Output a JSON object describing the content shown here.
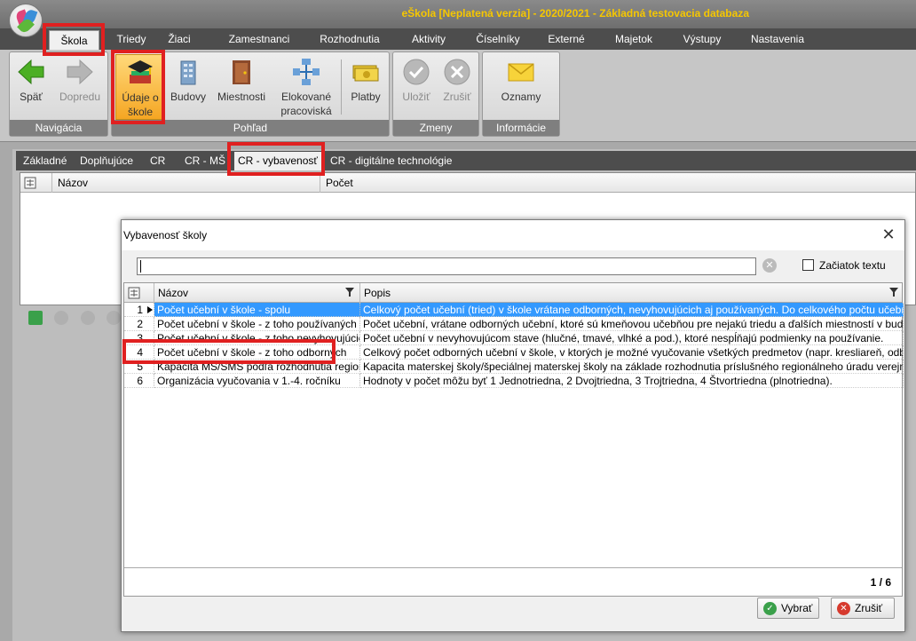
{
  "app": {
    "title": "eŠkola [Neplatená verzia] - 2020/2021 - Základná testovacia databaza"
  },
  "menu": {
    "tabs": [
      {
        "label": "Škola",
        "active": true
      },
      {
        "label": "Triedy"
      },
      {
        "label": "Žiaci"
      },
      {
        "label": "Zamestnanci"
      },
      {
        "label": "Rozhodnutia"
      },
      {
        "label": "Aktivity"
      },
      {
        "label": "Číselníky"
      },
      {
        "label": "Externé"
      },
      {
        "label": "Majetok"
      },
      {
        "label": "Výstupy"
      },
      {
        "label": "Nastavenia"
      }
    ]
  },
  "ribbon": {
    "groups": {
      "navigacia": "Navigácia",
      "pohlad": "Pohľad",
      "zmeny": "Zmeny",
      "informacie": "Informácie"
    },
    "buttons": {
      "back": "Späť",
      "forward": "Dopredu",
      "school_data_1": "Údaje o",
      "school_data_2": "škole",
      "buildings": "Budovy",
      "rooms": "Miestnosti",
      "workplaces_1": "Elokované",
      "workplaces_2": "pracoviská",
      "payments": "Platby",
      "save": "Uložiť",
      "cancel": "Zrušiť",
      "notices": "Oznamy"
    }
  },
  "subtabs": [
    "Základné",
    "Doplňujúce",
    "CR",
    "CR - MŠ",
    "CR - vybavenosť",
    "CR - digitálne technológie"
  ],
  "main_grid": {
    "columns": [
      "Názov",
      "Počet"
    ]
  },
  "dialog": {
    "title": "Vybavenosť školy",
    "search_value": "",
    "checkbox_label": "Začiatok textu",
    "columns": {
      "name": "Názov",
      "desc": "Popis"
    },
    "rows": [
      {
        "num": "1",
        "name": "Počet učební v škole - spolu",
        "desc": "Celkový počet učební (tried) v škole vrátane odborných, nevyhovujúcich aj používaných. Do celkového počtu učební sa neza..."
      },
      {
        "num": "2",
        "name": "Počet učební v škole - z toho používaných",
        "desc": "Počet učební, vrátane odborných učební, ktoré sú kmeňovou učebňou pre nejakú triedu a ďalších miestností v budove školy ..."
      },
      {
        "num": "3",
        "name": "Počet učební v škole - z toho nevyhovujúcich",
        "desc": "Počet učební v nevyhovujúcom stave (hlučné, tmavé, vlhké a pod.), ktoré nespĺňajú podmienky na používanie."
      },
      {
        "num": "4",
        "name": "Počet učební v škole - z toho odborných",
        "desc": "Celkový počet odborných učební v škole, v ktorých je možné vyučovanie všetkých predmetov (napr. kresliareň, odborná učeb..."
      },
      {
        "num": "5",
        "name": "Kapacita MŠ/ŠMŠ podľa rozhodnutia regionál...",
        "desc": "Kapacita materskej školy/špeciálnej materskej školy na základe rozhodnutia príslušného regionálneho úradu verejného zdravot..."
      },
      {
        "num": "6",
        "name": "Organizácia vyučovania v 1.-4. ročníku",
        "desc": "Hodnoty v počet môžu byť 1 Jednotriedna, 2 Dvojtriedna, 3 Trojtriedna, 4 Štvortriedna (plnotriedna)."
      }
    ],
    "count": "1 / 6",
    "ok_label": "Vybrať",
    "cancel_label": "Zrušiť"
  },
  "colors": {
    "accent": "#f6c700",
    "selection": "#3399ff",
    "highlight": "#e02020"
  }
}
